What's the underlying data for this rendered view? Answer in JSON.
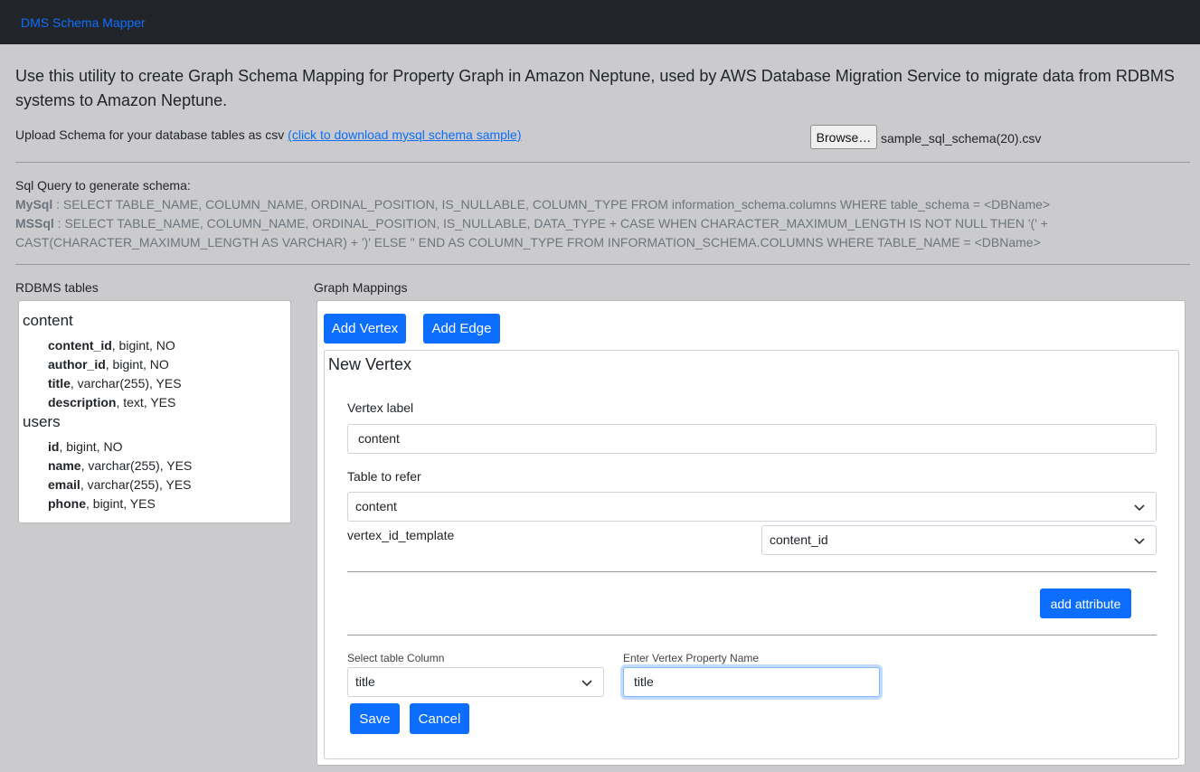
{
  "nav": {
    "brand": "DMS Schema Mapper"
  },
  "intro": "Use this utility to create Graph Schema Mapping for Property Graph in Amazon Neptune, used by AWS Database Migration Service to migrate data from RDBMS systems to Amazon Neptune.",
  "upload": {
    "label": "Upload Schema for your database tables as csv",
    "link": "(click to download mysql schema sample)",
    "browse": "Browse…",
    "file_name": "sample_sql_schema(20).csv"
  },
  "sql": {
    "title": "Sql Query to generate schema:",
    "mysql_label": "MySql",
    "mysql_query": " : SELECT TABLE_NAME, COLUMN_NAME, ORDINAL_POSITION, IS_NULLABLE, COLUMN_TYPE FROM information_schema.columns WHERE table_schema = <DBName>",
    "mssql_label": "MSSql",
    "mssql_query_1": " : SELECT TABLE_NAME, COLUMN_NAME, ORDINAL_POSITION, IS_NULLABLE, DATA_TYPE + CASE WHEN CHARACTER_MAXIMUM_LENGTH IS NOT NULL THEN '(' +",
    "mssql_query_2": "CAST(CHARACTER_MAXIMUM_LENGTH AS VARCHAR) + ')' ELSE '' END AS COLUMN_TYPE FROM INFORMATION_SCHEMA.COLUMNS WHERE TABLE_NAME = <DBName>"
  },
  "rdbms": {
    "title": "RDBMS tables",
    "tables": [
      {
        "name": "content",
        "columns": [
          {
            "name": "content_id",
            "meta": ", bigint, NO"
          },
          {
            "name": "author_id",
            "meta": ", bigint, NO"
          },
          {
            "name": "title",
            "meta": ", varchar(255), YES"
          },
          {
            "name": "description",
            "meta": ", text, YES"
          }
        ]
      },
      {
        "name": "users",
        "columns": [
          {
            "name": "id",
            "meta": ", bigint, NO"
          },
          {
            "name": "name",
            "meta": ", varchar(255), YES"
          },
          {
            "name": "email",
            "meta": ", varchar(255), YES"
          },
          {
            "name": "phone",
            "meta": ", bigint, YES"
          }
        ]
      }
    ]
  },
  "mapping": {
    "title": "Graph Mappings",
    "add_vertex": "Add Vertex",
    "add_edge": "Add Edge",
    "vertex": {
      "title": "New Vertex",
      "label_label": "Vertex label",
      "label_value": "content",
      "table_label": "Table to refer",
      "table_value": "content",
      "id_template_label": "vertex_id_template",
      "id_template_value": "content_id",
      "add_attribute": "add attribute",
      "column_label": "Select table Column",
      "column_value": "title",
      "property_label": "Enter Vertex Property Name",
      "property_value": "title",
      "save": "Save",
      "cancel": "Cancel"
    }
  },
  "colors": {
    "primary": "#0d6efd",
    "navbar": "#212529",
    "background": "#cbcbcd"
  }
}
